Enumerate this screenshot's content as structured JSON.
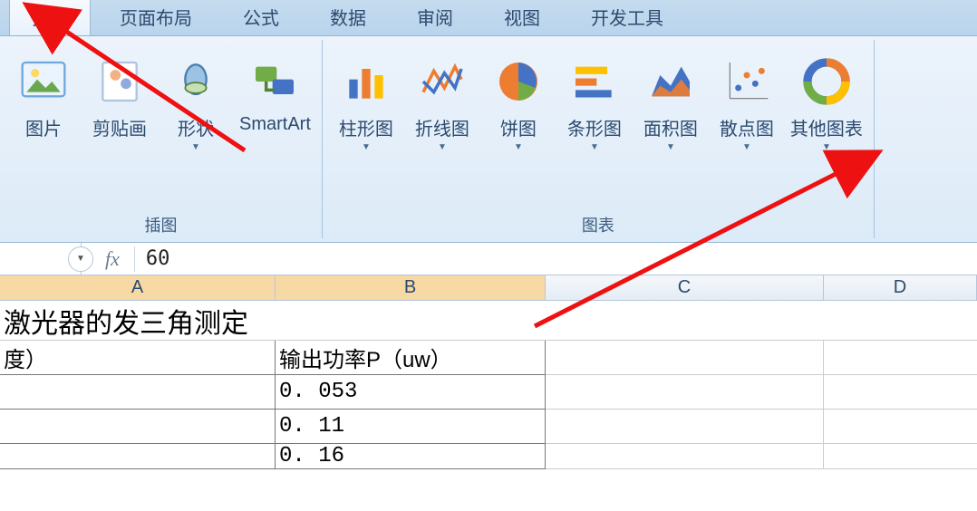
{
  "tabs": {
    "insert": "插入",
    "page_layout": "页面布局",
    "formulas": "公式",
    "data": "数据",
    "review": "审阅",
    "view": "视图",
    "developer": "开发工具"
  },
  "ribbon": {
    "illustrations": {
      "label": "插图",
      "picture": "图片",
      "clipart": "剪贴画",
      "shapes": "形状",
      "smartart": "SmartArt"
    },
    "charts": {
      "label": "图表",
      "column": "柱形图",
      "line": "折线图",
      "pie": "饼图",
      "bar": "条形图",
      "area": "面积图",
      "scatter": "散点图",
      "other": "其他图表"
    }
  },
  "formula_bar": {
    "fx": "fx",
    "value": "60"
  },
  "columns": [
    "A",
    "B",
    "C",
    "D"
  ],
  "sheet": {
    "title": "激光器的发三角测定",
    "header_a": "度）",
    "header_b": "输出功率P（uw）",
    "rows": [
      {
        "b": "0. 053"
      },
      {
        "b": "0. 11"
      },
      {
        "b": "0. 16"
      }
    ]
  },
  "dropdown_glyph": "▼"
}
